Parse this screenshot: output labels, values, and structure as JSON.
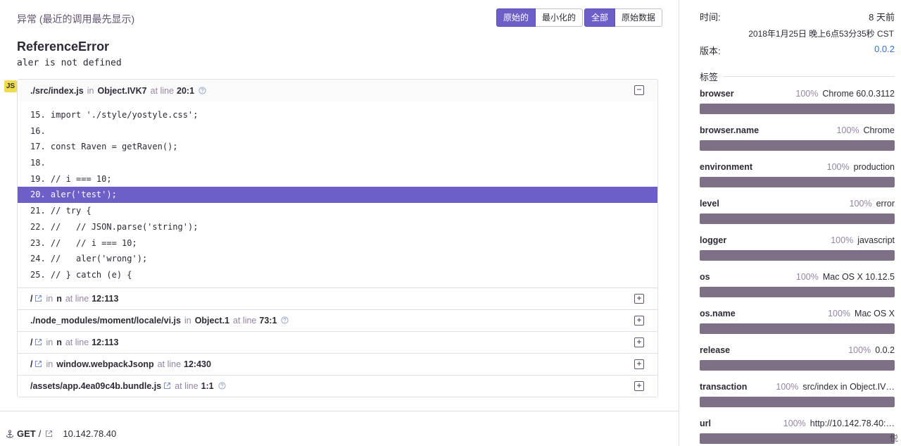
{
  "exception": {
    "header_title": "异常",
    "header_note": "(最近的调用最先显示)",
    "type": "ReferenceError",
    "value": "aler is not defined",
    "platform_badge": "JS",
    "buttons": {
      "original": "原始的",
      "minified": "最小化的",
      "all": "全部",
      "raw": "原始数据"
    }
  },
  "frames": [
    {
      "filename": "./src/index.js",
      "in_label": "in",
      "function": "Object.IVK7",
      "at_line_label": "at line",
      "lineno": "20:1",
      "expanded": true,
      "code": [
        "15. import './style/yostyle.css';",
        "16.",
        "17. const Raven = getRaven();",
        "18.",
        "19. // i === 10;",
        "20. aler('test');",
        "21. // try {",
        "22. //   // JSON.parse('string');",
        "23. //   // i === 10;",
        "24. //   aler('wrong');",
        "25. // } catch (e) {"
      ],
      "active_line_index": 5
    },
    {
      "filename": "/",
      "in_label": "in",
      "function": "n",
      "at_line_label": "at line",
      "lineno": "12:113"
    },
    {
      "filename": "./node_modules/moment/locale/vi.js",
      "in_label": "in",
      "function": "Object.1",
      "at_line_label": "at line",
      "lineno": "73:1"
    },
    {
      "filename": "/",
      "in_label": "in",
      "function": "n",
      "at_line_label": "at line",
      "lineno": "12:113"
    },
    {
      "filename": "/",
      "in_label": "in",
      "function": "window.webpackJsonp",
      "at_line_label": "at line",
      "lineno": "12:430"
    },
    {
      "filename": "/assets/app.4ea09c4b.bundle.js",
      "at_line_label": "at line",
      "lineno": "1:1"
    }
  ],
  "request": {
    "method": "GET",
    "path": "/",
    "ip": "10.142.78.40"
  },
  "sidebar": {
    "time_label": "时间:",
    "time_value": "8 天前",
    "time_full": "2018年1月25日 晚上6点53分35秒 CST",
    "version_label": "版本:",
    "version_value": "0.0.2",
    "tags_title": "标签",
    "tags": [
      {
        "key": "browser",
        "pct": "100%",
        "value": "Chrome 60.0.3112",
        "fraction": 1.0
      },
      {
        "key": "browser.name",
        "pct": "100%",
        "value": "Chrome",
        "fraction": 1.0
      },
      {
        "key": "environment",
        "pct": "100%",
        "value": "production",
        "fraction": 1.0
      },
      {
        "key": "level",
        "pct": "100%",
        "value": "error",
        "fraction": 1.0
      },
      {
        "key": "logger",
        "pct": "100%",
        "value": "javascript",
        "fraction": 1.0
      },
      {
        "key": "os",
        "pct": "100%",
        "value": "Mac OS X 10.12.5",
        "fraction": 1.0
      },
      {
        "key": "os.name",
        "pct": "100%",
        "value": "Mac OS X",
        "fraction": 1.0
      },
      {
        "key": "release",
        "pct": "100%",
        "value": "0.0.2",
        "fraction": 1.0
      },
      {
        "key": "transaction",
        "pct": "100%",
        "value": "src/index in Object.IV…",
        "fraction": 1.0
      },
      {
        "key": "url",
        "pct": "100%",
        "value": "http://10.142.78.40:…",
        "fraction": 1.0
      }
    ]
  },
  "watermark": "悦",
  "colors": {
    "accent": "#6c5fc7",
    "tag_bar": "#7e7087",
    "link": "#3b6ecc",
    "js_badge": "#f0db4f"
  }
}
